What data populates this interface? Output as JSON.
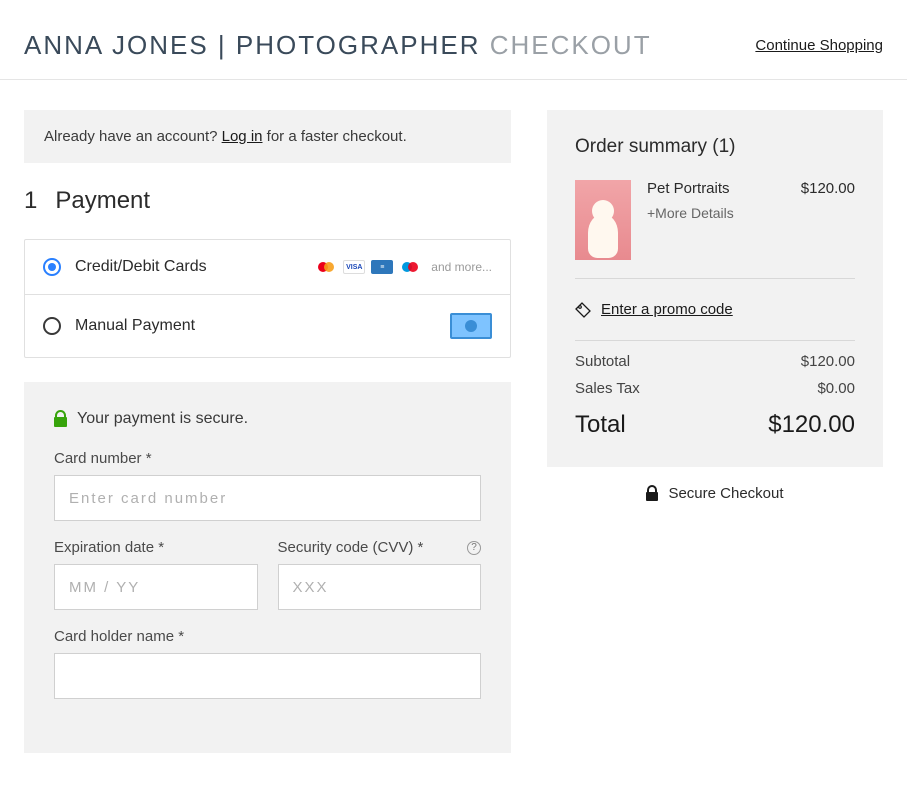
{
  "header": {
    "brand_main": "ANNA JONES | PHOTOGRAPHER",
    "brand_sub": " CHECKOUT",
    "continue_label": "Continue Shopping"
  },
  "login_banner": {
    "prefix": "Already have an account? ",
    "link": "Log in",
    "suffix": " for a faster checkout."
  },
  "payment": {
    "step_number": "1",
    "title": "Payment",
    "methods": {
      "card_label": "Credit/Debit Cards",
      "and_more": "and more...",
      "manual_label": "Manual Payment"
    },
    "secure_note": "Your payment is secure.",
    "fields": {
      "card_number_label": "Card number *",
      "card_number_placeholder": "Enter card number",
      "expiration_label": "Expiration date *",
      "expiration_placeholder": "MM / YY",
      "cvv_label": "Security code (CVV) *",
      "cvv_placeholder": "XXX",
      "holder_label": "Card holder name *"
    }
  },
  "summary": {
    "title": "Order summary (1)",
    "item": {
      "name": "Pet Portraits",
      "more": "+More Details",
      "price": "$120.00"
    },
    "promo_label": "Enter a promo code",
    "subtotal_label": "Subtotal",
    "subtotal_value": "$120.00",
    "tax_label": "Sales Tax",
    "tax_value": "$0.00",
    "total_label": "Total",
    "total_value": "$120.00",
    "secure_checkout": "Secure Checkout"
  }
}
